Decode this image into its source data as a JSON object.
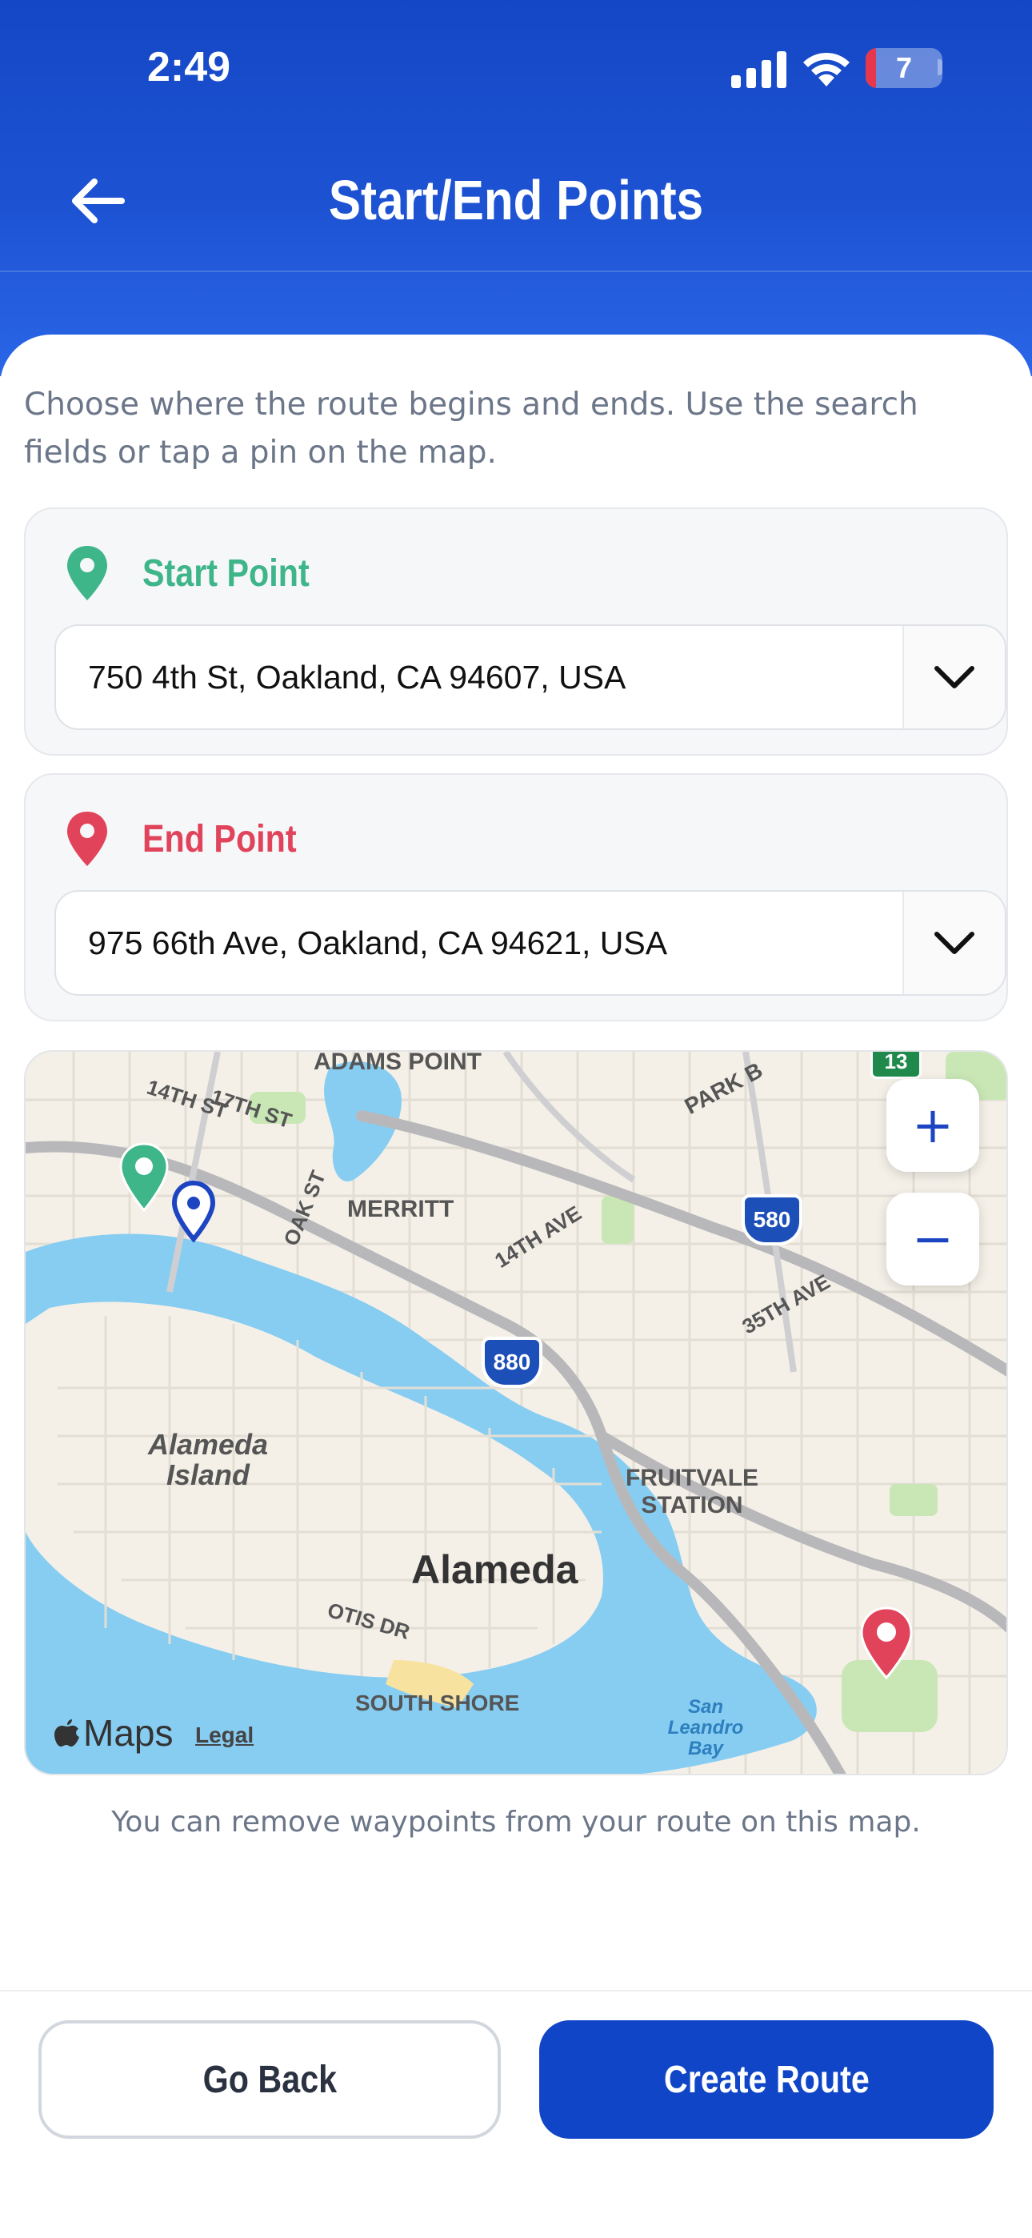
{
  "status_bar": {
    "time": "2:49",
    "battery": "7"
  },
  "header": {
    "title": "Start/End Points"
  },
  "intro_text": "Choose where the route begins and ends. Use the search fields or tap a pin on the map.",
  "start_point": {
    "label": "Start Point",
    "value": "750 4th St, Oakland, CA 94607, USA",
    "color": "#3fb58a"
  },
  "end_point": {
    "label": "End Point",
    "value": "975 66th Ave, Oakland, CA 94621, USA",
    "color": "#e0435a"
  },
  "map": {
    "labels": {
      "adams_point": "ADAMS POINT",
      "park_b": "PARK B",
      "s14th": "14TH ST",
      "s17th": "17TH ST",
      "oak_st": "OAK ST",
      "merritt": "MERRITT",
      "ave14th": "14TH AVE",
      "ave35th": "35TH AVE",
      "i580": "580",
      "i880": "880",
      "r13": "13",
      "alameda_island": "Alameda Island",
      "fruitvale": "FRUITVALE STATION",
      "alameda": "Alameda",
      "otis_dr": "OTIS DR",
      "south_shore": "SOUTH SHORE",
      "san_leandro_bay": "San Leandro Bay"
    },
    "zoom_in": "+",
    "zoom_out": "−",
    "brand": "Maps",
    "legal": "Legal"
  },
  "map_note": "You can remove waypoints from your route on this map.",
  "buttons": {
    "go_back": "Go Back",
    "create_route": "Create Route"
  }
}
